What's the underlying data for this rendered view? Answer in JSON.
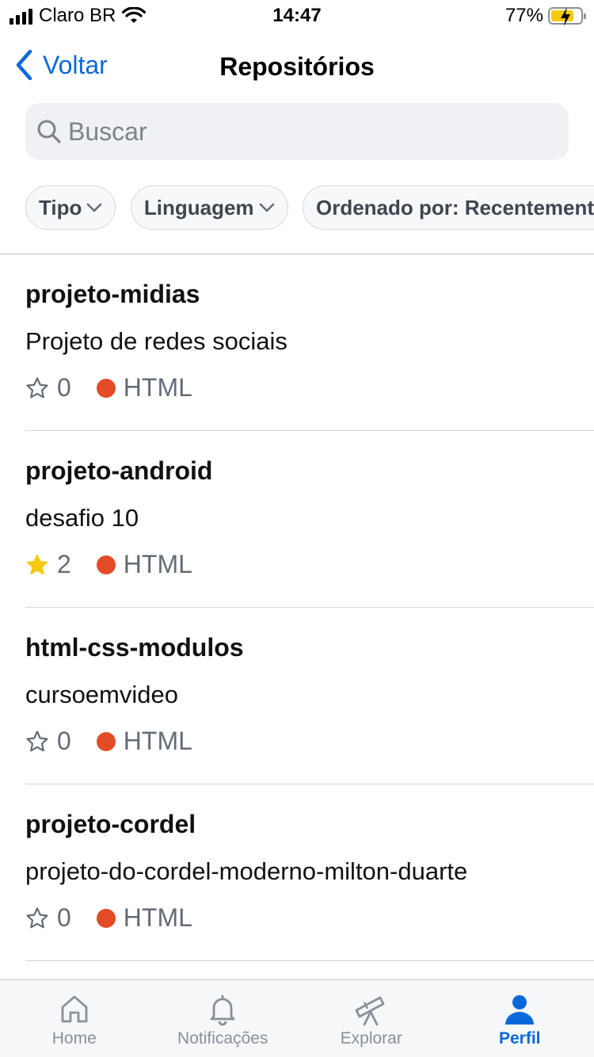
{
  "status_bar": {
    "carrier": "Claro BR",
    "time": "14:47",
    "battery": "77%",
    "battery_level": 0.77
  },
  "nav": {
    "back_label": "Voltar",
    "title": "Repositórios"
  },
  "search": {
    "placeholder": "Buscar"
  },
  "filters": [
    {
      "label": "Tipo"
    },
    {
      "label": "Linguagem"
    },
    {
      "label": "Ordenado por: Recentemente"
    }
  ],
  "repos": [
    {
      "name": "projeto-midias",
      "description": "Projeto de redes sociais",
      "stars": "0",
      "starred": false,
      "language": "HTML"
    },
    {
      "name": "projeto-android",
      "description": "desafio 10",
      "stars": "2",
      "starred": true,
      "language": "HTML"
    },
    {
      "name": "html-css-modulos",
      "description": "cursoemvideo",
      "stars": "0",
      "starred": false,
      "language": "HTML"
    },
    {
      "name": "projeto-cordel",
      "description": "projeto-do-cordel-moderno-milton-duarte",
      "stars": "0",
      "starred": false,
      "language": "HTML"
    }
  ],
  "tabs": [
    {
      "label": "Home",
      "icon": "home-icon",
      "active": false
    },
    {
      "label": "Notificações",
      "icon": "bell-icon",
      "active": false
    },
    {
      "label": "Explorar",
      "icon": "telescope-icon",
      "active": false
    },
    {
      "label": "Perfil",
      "icon": "person-icon",
      "active": true
    }
  ],
  "colors": {
    "accent": "#0969da",
    "html_language": "#e34c26",
    "star_filled": "#f6c90e"
  }
}
